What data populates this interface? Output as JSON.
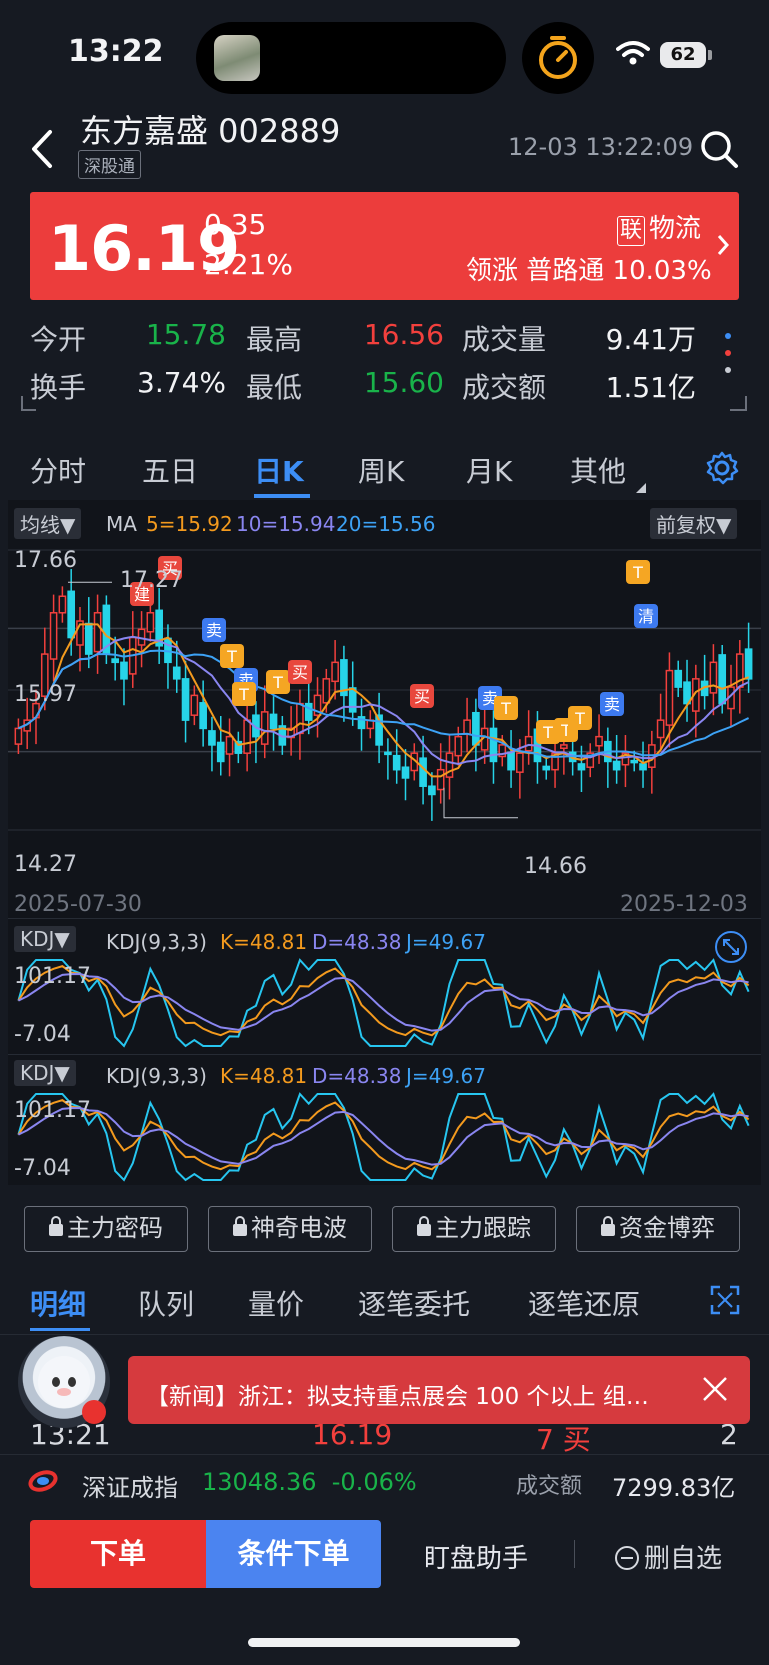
{
  "status_bar": {
    "time": "13:22",
    "battery": "62"
  },
  "header": {
    "stock_name": "东方嘉盛 002889",
    "tag": "深股通",
    "datetime": "12-03 13:22:09"
  },
  "quote": {
    "price": "16.19",
    "change": "0.35",
    "change_pct": "2.21%",
    "sector_badge": "联",
    "sector": "物流",
    "leader": "领涨 普路通 10.03%",
    "colors": {
      "up": "#f2403d",
      "down": "#19b34a",
      "banner": "#ec3d3c"
    }
  },
  "stats": {
    "open_label": "今开",
    "open": "15.78",
    "high_label": "最高",
    "high": "16.56",
    "volume_label": "成交量",
    "volume": "9.41万",
    "turnover_label": "换手",
    "turnover": "3.74%",
    "low_label": "最低",
    "low": "15.60",
    "amount_label": "成交额",
    "amount": "1.51亿"
  },
  "chart_tabs": [
    "分时",
    "五日",
    "日K",
    "周K",
    "月K",
    "其他"
  ],
  "chart_tabs_active": "日K",
  "kline": {
    "ma_chip": "均线▼",
    "ma_label": "MA",
    "ma5": "5=15.92",
    "ma10": "10=15.94",
    "ma20": "20=15.56",
    "adjust_chip": "前复权▼",
    "y_top": "17.66",
    "y_mid": "15.97",
    "y_bottom": "14.27",
    "hi_label": "17.27",
    "lo_label": "14.66",
    "date_start": "2025-07-30",
    "date_end": "2025-12-03",
    "markers": [
      "建",
      "买",
      "卖",
      "T",
      "卖",
      "T",
      "T",
      "买",
      "买",
      "卖",
      "T",
      "T",
      "T",
      "T",
      "卖",
      "T",
      "清"
    ]
  },
  "kdj1": {
    "chip": "KDJ▼",
    "label": "KDJ(9,3,3)",
    "k": "K=48.81",
    "d": "D=48.38",
    "j": "J=49.67",
    "y_top": "101.17",
    "y_bottom": "-7.04"
  },
  "kdj2": {
    "chip": "KDJ▼",
    "label": "KDJ(9,3,3)",
    "k": "K=48.81",
    "d": "D=48.38",
    "j": "J=49.67",
    "y_top": "101.17",
    "y_bottom": "-7.04"
  },
  "lock_buttons": [
    "主力密码",
    "神奇电波",
    "主力跟踪",
    "资金博弈"
  ],
  "detail_tabs": [
    "明细",
    "队列",
    "量价",
    "逐笔委托",
    "逐笔还原"
  ],
  "news": {
    "text": "【新闻】浙江：拟支持重点展会 100 个以上 组…"
  },
  "trade_row": {
    "time": "13:21",
    "price": "16.19",
    "volume": "7 买",
    "count": "2"
  },
  "index": {
    "name": "深证成指",
    "value": "13048.36  -0.06%",
    "amount_label": "成交额",
    "amount": "7299.83亿"
  },
  "bottom_bar": {
    "order": "下单",
    "conditional": "条件下单",
    "assistant": "盯盘助手",
    "remove": "删自选"
  },
  "chart_data": {
    "type": "candlestick",
    "title": "",
    "x_range": [
      "2025-07-30",
      "2025-12-03"
    ],
    "ylim": [
      14.27,
      17.66
    ],
    "highlights": {
      "high": 17.27,
      "low": 14.66
    },
    "ma": {
      "MA5": 15.92,
      "MA10": 15.94,
      "MA20": 15.56
    },
    "close_series": [
      15.5,
      15.6,
      15.8,
      16.4,
      16.9,
      17.1,
      16.6,
      16.8,
      16.4,
      16.9,
      16.4,
      16.3,
      16.1,
      16.6,
      16.7,
      16.9,
      16.5,
      16.3,
      16.1,
      15.6,
      15.9,
      15.5,
      15.3,
      15.1,
      15.4,
      15.2,
      15.6,
      15.4,
      15.7,
      15.5,
      15.3,
      15.5,
      15.8,
      15.6,
      15.9,
      16.1,
      16.3,
      15.9,
      15.7,
      15.5,
      15.6,
      15.3,
      15.2,
      15.0,
      14.9,
      15.2,
      14.8,
      14.7,
      15.0,
      15.2,
      15.4,
      15.6,
      15.3,
      15.5,
      15.1,
      15.3,
      15.0,
      15.2,
      15.4,
      15.1,
      15.0,
      15.2,
      15.3,
      15.1,
      15.0,
      15.2,
      15.4,
      15.1,
      15.0,
      15.2,
      15.1,
      15.0,
      15.3,
      15.6,
      16.2,
      16.0,
      15.8,
      16.1,
      15.9,
      16.3,
      15.8,
      16.0,
      16.4,
      16.1
    ],
    "kdj": {
      "K": 48.81,
      "D": 48.38,
      "J": 49.67,
      "ylim": [
        -7.04,
        101.17
      ]
    }
  }
}
